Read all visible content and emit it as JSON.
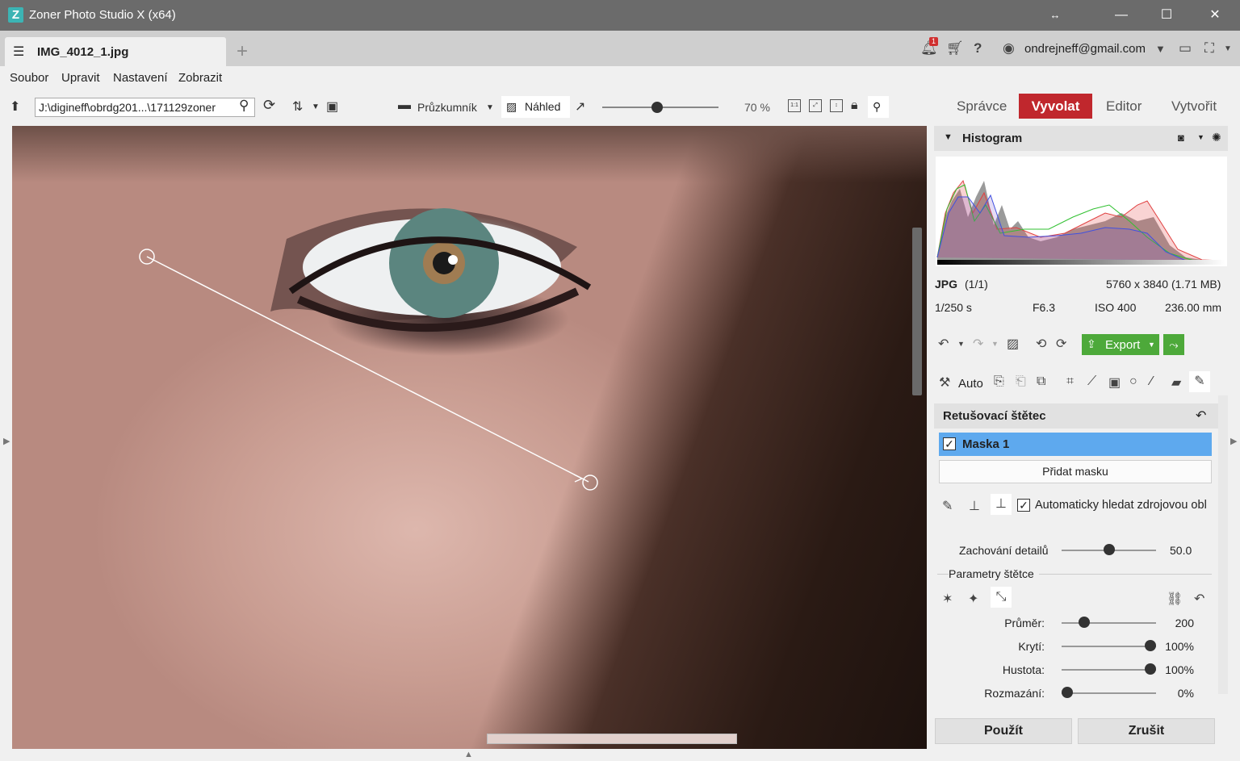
{
  "window": {
    "title": "Zoner Photo Studio X (x64)",
    "logo": "Z",
    "resize_glyph": "↔",
    "minimize_glyph": "—",
    "maximize_glyph": "☐",
    "close_glyph": "✕"
  },
  "tab": {
    "icon": "sliders-icon",
    "name": "IMG_4012_1.jpg",
    "add_glyph": "+"
  },
  "topbar": {
    "notification_count": "1",
    "help": "?",
    "email": "ondrejneff@gmail.com"
  },
  "menu": [
    "Soubor",
    "Upravit",
    "Nastavení",
    "Zobrazit"
  ],
  "toolbar": {
    "path": "J:\\digineff\\obrdg201...\\171129zoner",
    "browser_label": "Průzkumník",
    "preview_label": "Náhled",
    "zoom": 0.47,
    "zoom_label": "70 %",
    "one_to_one": "1:1"
  },
  "modes": [
    "Správce",
    "Vyvolat",
    "Editor",
    "Vytvořit"
  ],
  "active_mode": "Vyvolat",
  "histogram": {
    "title": "Histogram"
  },
  "file_info": {
    "format": "JPG",
    "count": "(1/1)",
    "dimensions": "5760 x 3840 (1.71 MB)",
    "shutter": "1/250 s",
    "aperture": "F6.3",
    "iso": "ISO 400",
    "focal": "236.00 mm"
  },
  "export_label": "Export",
  "auto_label": "Auto",
  "retouch": {
    "title": "Retušovací štětec",
    "mask_label": "Maska 1",
    "add_mask": "Přidat masku",
    "auto_source": "Automaticky hledat zdrojovou obl",
    "check": "✓",
    "detail_label": "Zachování detailů",
    "detail_value": "50.0",
    "detail_level": 0.5,
    "brush_params": "Parametry štětce",
    "sliders": [
      {
        "label": "Průměr:",
        "value": "200",
        "level": 0.2
      },
      {
        "label": "Krytí:",
        "value": "100%",
        "level": 1.0
      },
      {
        "label": "Hustota:",
        "value": "100%",
        "level": 1.0
      },
      {
        "label": "Rozmazání:",
        "value": "0%",
        "level": 0.0
      }
    ]
  },
  "buttons": {
    "apply": "Použít",
    "cancel": "Zrušit"
  }
}
